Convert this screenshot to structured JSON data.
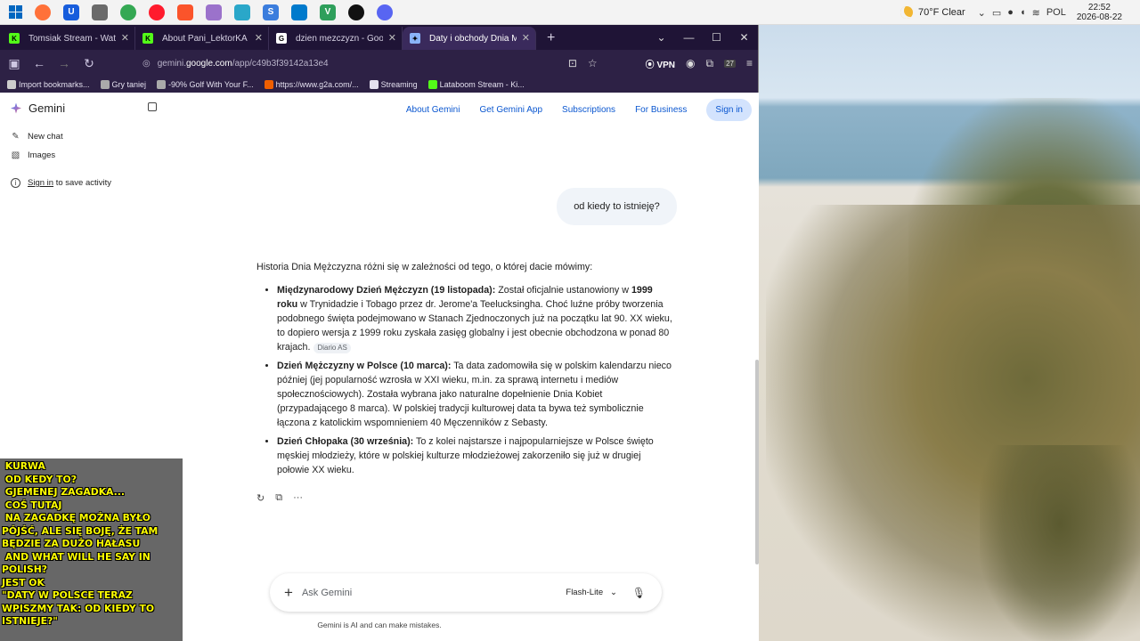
{
  "taskbar": {
    "apps": [
      {
        "name": "firefox",
        "color": "#ff7139"
      },
      {
        "name": "bitwarden",
        "color": "#175ddc",
        "glyph": "U"
      },
      {
        "name": "library",
        "color": "#6a6a6a"
      },
      {
        "name": "chrome",
        "color": "#34a853"
      },
      {
        "name": "opera",
        "color": "#ff1b2d"
      },
      {
        "name": "brave",
        "color": "#fb542b"
      },
      {
        "name": "copilot",
        "color": "#9b72cb"
      },
      {
        "name": "edge",
        "color": "#2aa7c9"
      },
      {
        "name": "s-app",
        "color": "#3b7ddd",
        "glyph": "S"
      },
      {
        "name": "vscode",
        "color": "#007acc"
      },
      {
        "name": "veeam",
        "color": "#2e9f5b",
        "glyph": "V"
      },
      {
        "name": "obs",
        "color": "#111111"
      },
      {
        "name": "discord",
        "color": "#5865f2"
      }
    ],
    "weather": "70°F  Clear",
    "lang": "POL",
    "time": "22:52",
    "date": "2026-08-22"
  },
  "tabs": [
    {
      "title": "Tomsiak Stream - Watch Li",
      "favicon_color": "#53fc18",
      "favicon": "K"
    },
    {
      "title": "About Pani_LektorKA - Watch Li",
      "favicon_color": "#53fc18",
      "favicon": "K"
    },
    {
      "title": "dzien mezczyzn - Google Searc",
      "favicon_color": "#ffffff",
      "favicon": "G"
    },
    {
      "title": "Daty i obchody Dnia Mężczyzn",
      "favicon_color": "#8ab4f8",
      "favicon": "✦",
      "active": true
    }
  ],
  "toolbar": {
    "url_prefix": "gemini.",
    "url_host": "google.com",
    "url_path": "/app/c49b3f39142a13e4",
    "vpn": "VPN",
    "badge": "27"
  },
  "bookmarks": [
    {
      "label": "Import bookmarks...",
      "color": "#cccccc"
    },
    {
      "label": "Gry taniej",
      "color": "#aaaaaa"
    },
    {
      "label": "-90% Golf With Your F...",
      "color": "#aaaaaa"
    },
    {
      "label": "https://www.g2a.com/...",
      "color": "#f05f00"
    },
    {
      "label": "Streaming",
      "color": "#e4e0ef"
    },
    {
      "label": "Lataboom Stream - Ki...",
      "color": "#53fc18"
    }
  ],
  "sidebar": {
    "brand": "Gemini",
    "new_chat": "New chat",
    "images": "Images",
    "signin_link": "Sign in",
    "signin_rest": " to save activity"
  },
  "topnav": {
    "about": "About Gemini",
    "get_app": "Get Gemini App",
    "subscriptions": "Subscriptions",
    "business": "For Business",
    "signin": "Sign in"
  },
  "conversation": {
    "user_message": "od kiedy to istnieję?",
    "intro": "Historia Dnia Mężczyzna różni się w zależności od tego, o której dacie mówimy:",
    "items": [
      {
        "title": "Międzynarodowy Dzień Mężczyzn (19 listopada):",
        "text_a": " Został oficjalnie ustanowiony w ",
        "bold": "1999 roku",
        "text_b": " w Trynidadzie i Tobago przez dr. Jerome'a Teelucksingha. Choć luźne próby tworzenia podobnego święta podejmowano w Stanach Zjednoczonych już na początku lat 90. XX wieku, to dopiero wersja z 1999 roku zyskała zasięg globalny i jest obecnie obchodzona w ponad 80 krajach.",
        "source": "Diario AS"
      },
      {
        "title": "Dzień Mężczyzny w Polsce (10 marca):",
        "text": " Ta data zadomowiła się w polskim kalendarzu nieco później (jej popularność wzrosła w XXI wieku, m.in. za sprawą internetu i mediów społecznościowych). Została wybrana jako naturalne dopełnienie Dnia Kobiet (przypadającego 8 marca). W polskiej tradycji kulturowej data ta bywa też symbolicznie łączona z katolickim wspomnieniem 40 Męczenników z Sebasty."
      },
      {
        "title": "Dzień Chłopaka (30 września):",
        "text": " To z kolei najstarsze i najpopularniejsze w Polsce święto męskiej młodzieży, które w polskiej kulturze młodzieżowej zakorzeniło się już w drugiej połowie XX wieku."
      }
    ]
  },
  "composer": {
    "placeholder": "Ask Gemini",
    "model": "Flash-Lite",
    "disclaimer": "Gemini is AI and can make mistakes."
  },
  "chat_overlay": [
    " KURWA",
    " OD KEDY TO?",
    " GJEMENEJ ZAGADKA...",
    " COŚ TUTAJ",
    " NA ZAGADKĘ MOŻNA BYŁO PÓJŚĆ, ALE SIĘ BOJĘ, ŻE TAM BĘDZIE ZA DUŻO HAŁASU",
    " AND WHAT WILL HE SAY IN POLISH?",
    "JEST OK",
    "\"DATY W POLSCE TERAZ WPISZMY TAK: OD KIEDY TO ISTNIEJE?\""
  ]
}
